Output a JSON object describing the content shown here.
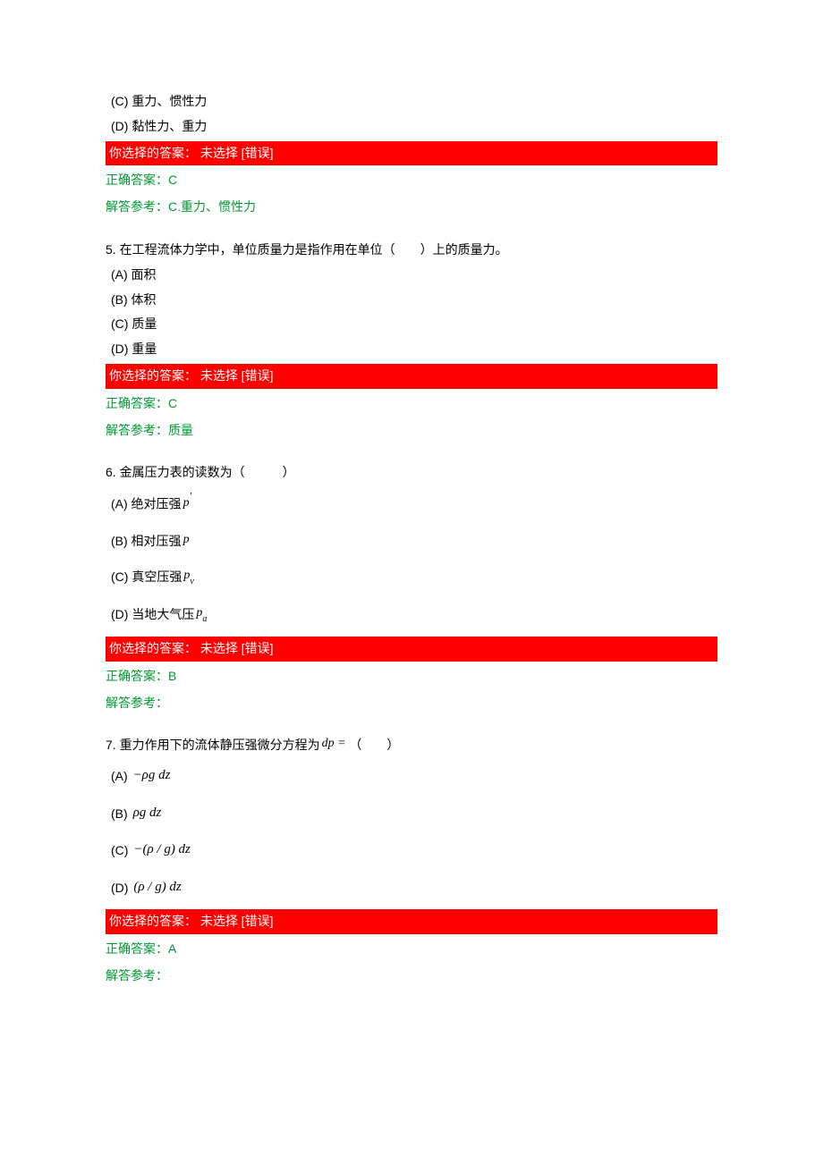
{
  "q4_partial": {
    "options": {
      "c": "(C) 重力、惯性力",
      "d": "(D) 黏性力、重力"
    },
    "error_bar": "你选择的答案： 未选择  [错误]",
    "correct": "正确答案：C",
    "explain": "解答参考：C.重力、惯性力"
  },
  "q5": {
    "prompt": "5.  在工程流体力学中，单位质量力是指作用在单位（　　）上的质量力。",
    "options": {
      "a": "(A) 面积",
      "b": "(B) 体积",
      "c": "(C) 质量",
      "d": "(D) 重量"
    },
    "error_bar": "你选择的答案： 未选择  [错误]",
    "correct": "正确答案：C",
    "explain": "解答参考：质量"
  },
  "q6": {
    "prompt": "6.  金属压力表的读数为（　　　）",
    "options": {
      "a_label": "(A) 绝对压强",
      "a_sym": "p",
      "a_sup": "'",
      "b_label": "(B) 相对压强",
      "b_sym": "p",
      "c_label": "(C) 真空压强",
      "c_sym": "p",
      "c_sub": "v",
      "d_label": "(D) 当地大气压",
      "d_sym": "p",
      "d_sub": "a"
    },
    "error_bar": "你选择的答案： 未选择  [错误]",
    "correct": "正确答案：B",
    "explain": "解答参考："
  },
  "q7": {
    "prompt_pre": "7.  重力作用下的流体静压强微分方程为",
    "prompt_math": "dp =",
    "prompt_post": " （　　）",
    "options": {
      "a_label": "(A) ",
      "a_math": "−ρg dz",
      "b_label": "(B) ",
      "b_math": "ρg dz",
      "c_label": "(C) ",
      "c_math": "−(ρ / g)  dz",
      "d_label": "(D) ",
      "d_math": "(ρ / g)  dz"
    },
    "error_bar": "你选择的答案： 未选择  [错误]",
    "correct": "正确答案：A",
    "explain": "解答参考："
  }
}
